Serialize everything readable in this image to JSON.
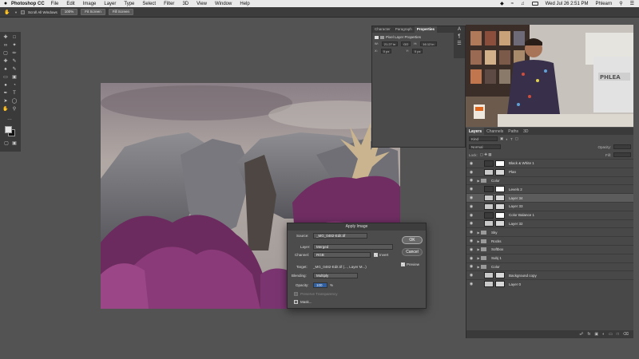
{
  "menubar": {
    "app_name": "Photoshop CC",
    "menus": [
      "File",
      "Edit",
      "Image",
      "Layer",
      "Type",
      "Select",
      "Filter",
      "3D",
      "View",
      "Window",
      "Help"
    ],
    "clock": "Wed Jul 26  2:51 PM",
    "user": "Phlearn"
  },
  "options_bar": {
    "scroll_all_label": "Scroll All Windows",
    "zoom_value": "100%",
    "fit_screen_label": "Fit Screen",
    "fill_screen_label": "Fill Screen"
  },
  "properties": {
    "tabs": [
      "Character",
      "Paragraph",
      "Properties"
    ],
    "active_tab": "Properties",
    "subheading": "Pixel Layer Properties",
    "w_label": "W:",
    "w_value": "21.27 in",
    "go_label": "GO",
    "h_label": "H:",
    "h_value": "16.12 in",
    "x_label": "X:",
    "x_value": "0 px",
    "y_label": "Y:",
    "y_value": "0 px"
  },
  "layers_panel": {
    "tabs": [
      "Layers",
      "Channels",
      "Paths",
      "3D"
    ],
    "active_tab": "Layers",
    "filter_label": "Kind",
    "blend_mode": "Normal",
    "opacity_label": "Opacity:",
    "lock_label": "Lock:",
    "fill_label": "Fill:",
    "layers": [
      {
        "name": "Black & White 1",
        "type": "adjustment"
      },
      {
        "name": "Plan",
        "type": "layer"
      },
      {
        "name": "Color",
        "type": "group"
      },
      {
        "name": "Levels 2",
        "type": "adjustment"
      },
      {
        "name": "Layer 34",
        "type": "layer",
        "selected": true
      },
      {
        "name": "Layer 33",
        "type": "layer"
      },
      {
        "name": "Color Balance 1",
        "type": "adjustment"
      },
      {
        "name": "Layer 32",
        "type": "layer"
      },
      {
        "name": "Sky",
        "type": "group"
      },
      {
        "name": "Rocks",
        "type": "group"
      },
      {
        "name": "Softbox",
        "type": "group"
      },
      {
        "name": "Subj 1",
        "type": "group"
      },
      {
        "name": "Color",
        "type": "group"
      },
      {
        "name": "Background copy",
        "type": "layer"
      },
      {
        "name": "Layer 0",
        "type": "layer"
      }
    ]
  },
  "dialog": {
    "title": "Apply Image",
    "source_label": "Source:",
    "source_value": "_MG_0482-Edit.tif",
    "layer_label": "Layer:",
    "layer_value": "Merged",
    "channel_label": "Channel:",
    "channel_value": "RGB",
    "invert_label": "Invert",
    "invert_checked": true,
    "target_label": "Target:",
    "target_value": "_MG_0482-Edit.tif (..., Layer M...)",
    "blending_label": "Blending:",
    "blending_value": "Multiply",
    "opacity_label": "Opacity:",
    "opacity_value": "100",
    "opacity_unit": "%",
    "preserve_label": "Preserve Transparency",
    "mask_label": "Mask...",
    "ok_label": "OK",
    "cancel_label": "Cancel",
    "preview_label": "Preview",
    "preview_checked": true
  }
}
